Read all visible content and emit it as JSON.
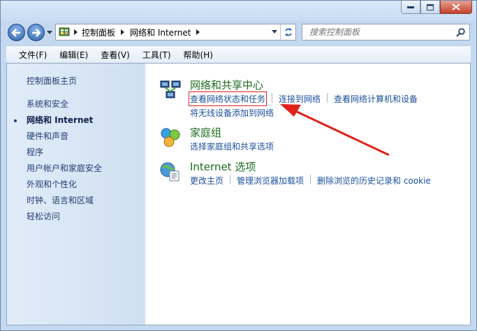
{
  "address": {
    "crumbs": [
      "控制面板",
      "网络和 Internet"
    ]
  },
  "search": {
    "placeholder": "搜索控制面板"
  },
  "menu": [
    "文件(F)",
    "编辑(E)",
    "查看(V)",
    "工具(T)",
    "帮助(H)"
  ],
  "sidebar": {
    "home": "控制面板主页",
    "items": [
      "系统和安全",
      "网络和 Internet",
      "硬件和声音",
      "程序",
      "用户帐户和家庭安全",
      "外观和个性化",
      "时钟、语言和区域",
      "轻松访问"
    ],
    "active_index": 1
  },
  "sections": [
    {
      "title": "网络和共享中心",
      "icon": "network-sharing-icon",
      "links": [
        "查看网络状态和任务",
        "连接到网络",
        "查看网络计算机和设备"
      ],
      "links2": [
        "将无线设备添加到网络"
      ]
    },
    {
      "title": "家庭组",
      "icon": "homegroup-icon",
      "links": [
        "选择家庭组和共享选项"
      ]
    },
    {
      "title": "Internet 选项",
      "icon": "internet-options-icon",
      "links": [
        "更改主页",
        "管理浏览器加载项",
        "删除浏览的历史记录和 cookie"
      ]
    }
  ],
  "colors": {
    "annotation": "#e0211a",
    "link": "#1a4f9c",
    "heading": "#1e6b1e"
  }
}
